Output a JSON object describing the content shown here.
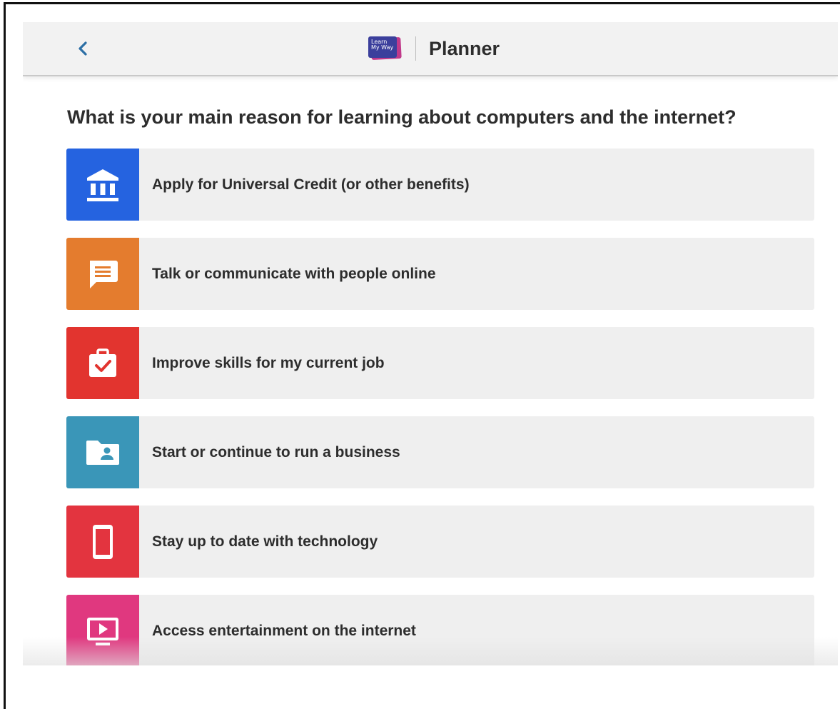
{
  "header": {
    "back_icon": "chevron-left-icon",
    "logo_text": "Learn My Way",
    "title": "Planner"
  },
  "question": "What is your main reason for learning about computers and the internet?",
  "options": [
    {
      "label": "Apply for Universal Credit (or other benefits)",
      "icon": "bank-icon",
      "color": "#2563e0"
    },
    {
      "label": "Talk or communicate with people online",
      "icon": "chat-icon",
      "color": "#e47c2e"
    },
    {
      "label": "Improve skills for my current job",
      "icon": "briefcase-check-icon",
      "color": "#e2342f"
    },
    {
      "label": "Start or continue to run a business",
      "icon": "folder-user-icon",
      "color": "#3a96b8"
    },
    {
      "label": "Stay up to date with technology",
      "icon": "smartphone-icon",
      "color": "#e3343f"
    },
    {
      "label": "Access entertainment on the internet",
      "icon": "play-screen-icon",
      "color": "#e0387f"
    }
  ],
  "colors": {
    "accent": "#2c6fa5",
    "header_bg": "#f2f2f2",
    "option_bg": "#efefef"
  }
}
